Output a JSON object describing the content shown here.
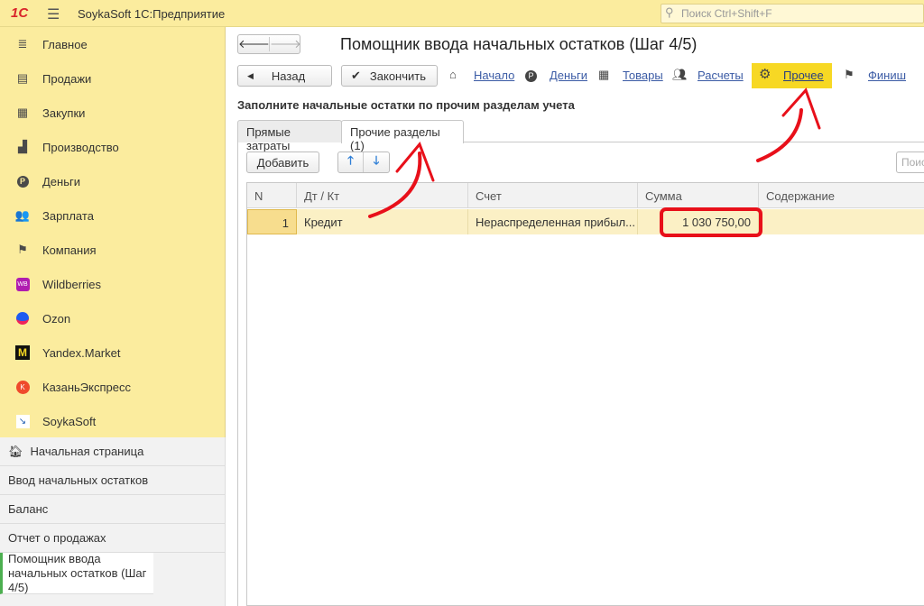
{
  "topbar": {
    "logo": "1С",
    "app_title": "SoykaSoft 1С:Предприятие",
    "search_placeholder": "Поиск Ctrl+Shift+F"
  },
  "sidebar": {
    "items": [
      {
        "label": "Главное",
        "icon": "list-icon"
      },
      {
        "label": "Продажи",
        "icon": "basket-icon"
      },
      {
        "label": "Закупки",
        "icon": "cart-icon"
      },
      {
        "label": "Производство",
        "icon": "factory-icon"
      },
      {
        "label": "Деньги",
        "icon": "ruble-icon"
      },
      {
        "label": "Зарплата",
        "icon": "people-icon"
      },
      {
        "label": "Компания",
        "icon": "flag-icon"
      },
      {
        "label": "Wildberries",
        "icon": "wildberries-icon"
      },
      {
        "label": "Ozon",
        "icon": "ozon-icon"
      },
      {
        "label": "Yandex.Market",
        "icon": "yandex-market-icon"
      },
      {
        "label": "КазаньЭкспресс",
        "icon": "kazanexpress-icon"
      },
      {
        "label": "SoykaSoft",
        "icon": "soykasoft-icon"
      }
    ]
  },
  "open_windows": [
    {
      "label": "Начальная страница"
    },
    {
      "label": "Ввод начальных остатков"
    },
    {
      "label": "Баланс"
    },
    {
      "label": "Отчет о продажах"
    },
    {
      "label": "Помощник ввода начальных остатков (Шаг 4/5)"
    }
  ],
  "main": {
    "title": "Помощник ввода начальных остатков (Шаг 4/5)",
    "back_label": "Назад",
    "finish_label": "Закончить",
    "steps": [
      {
        "label": "Начало"
      },
      {
        "label": "Деньги"
      },
      {
        "label": "Товары"
      },
      {
        "label": "Расчеты"
      },
      {
        "label": "Прочее"
      },
      {
        "label": "Финиш"
      }
    ],
    "heading": "Заполните начальные остатки по прочим разделам учета",
    "tabs": [
      {
        "label": "Прямые затраты"
      },
      {
        "label": "Прочие разделы (1)"
      }
    ],
    "add_label": "Добавить",
    "search_placeholder": "Поиск",
    "table": {
      "columns": [
        "N",
        "Дт / Кт",
        "Счет",
        "Сумма",
        "Содержание"
      ],
      "rows": [
        {
          "n": "1",
          "dtkt": "Кредит",
          "account": "Нераспределенная прибыл...",
          "sum": "1 030 750,00",
          "content": ""
        }
      ]
    }
  },
  "colors": {
    "accent": "#f7d824",
    "annotation": "#e8101a",
    "sidebar": "#fbec9e"
  }
}
